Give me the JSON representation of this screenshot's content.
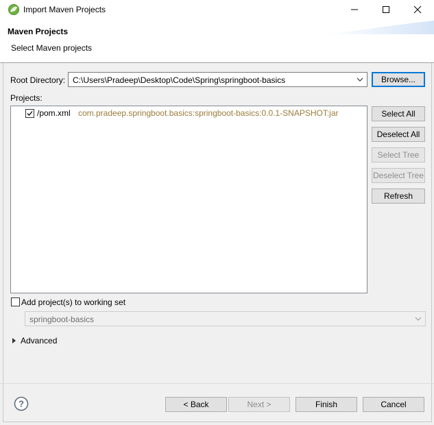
{
  "window": {
    "title": "Import Maven Projects"
  },
  "header": {
    "title": "Maven Projects",
    "subtitle": "Select Maven projects"
  },
  "root_directory": {
    "label": "Root Directory:",
    "value": "C:\\Users\\Pradeep\\Desktop\\Code\\Spring\\springboot-basics",
    "browse_label": "Browse..."
  },
  "projects": {
    "label": "Projects:",
    "items": [
      {
        "checked": true,
        "name": "/pom.xml",
        "id": "com.pradeep.springboot.basics:springboot-basics:0.0.1-SNAPSHOT:jar"
      }
    ]
  },
  "side_buttons": {
    "select_all": "Select All",
    "deselect_all": "Deselect All",
    "select_tree": "Select Tree",
    "deselect_tree": "Deselect Tree",
    "refresh": "Refresh"
  },
  "working_set": {
    "checkbox_label": "Add project(s) to working set",
    "checked": false,
    "value": "springboot-basics"
  },
  "advanced": {
    "label": "Advanced"
  },
  "footer": {
    "back": "< Back",
    "next": "Next >",
    "finish": "Finish",
    "cancel": "Cancel"
  },
  "colors": {
    "accent": "#0078d7",
    "project_id": "#9b7b3a"
  }
}
